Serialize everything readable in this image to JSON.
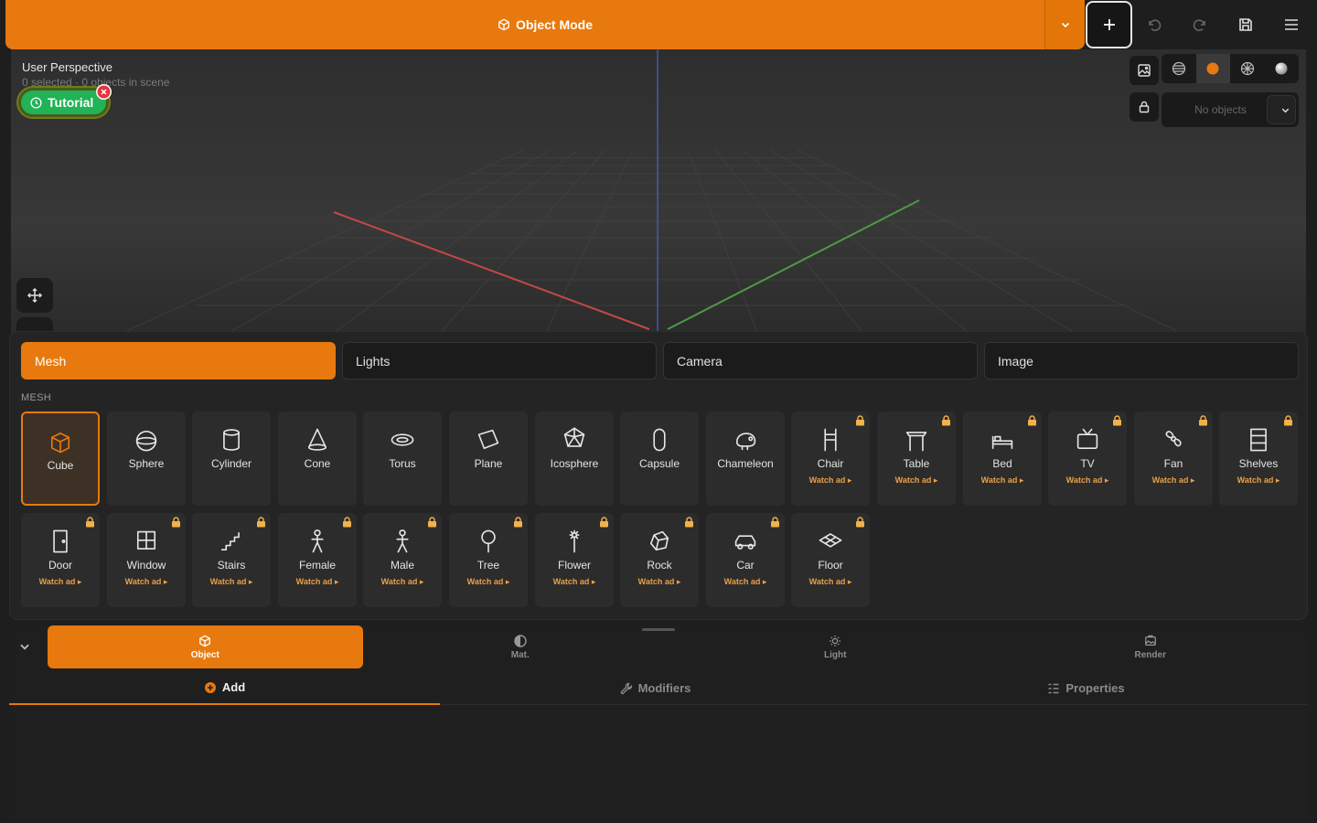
{
  "topbar": {
    "mode_label": "Object Mode",
    "icons": [
      "cube-icon",
      "chevron-down-icon",
      "plus-icon",
      "undo-icon",
      "redo-icon",
      "save-icon",
      "menu-icon"
    ]
  },
  "viewport": {
    "title": "User Perspective",
    "subtitle": "0 selected · 0 objects in scene",
    "tutorial_label": "Tutorial",
    "object_select_placeholder": "No objects",
    "shading_modes": [
      "wireframe",
      "solid",
      "material",
      "rendered"
    ],
    "active_shading": "solid"
  },
  "add_panel": {
    "categories": [
      "Mesh",
      "Lights",
      "Camera",
      "Image"
    ],
    "active_category": "Mesh",
    "section_label": "MESH",
    "ad_label": "Watch ad ▸",
    "items": [
      {
        "name": "Cube",
        "locked": false,
        "selected": true
      },
      {
        "name": "Sphere",
        "locked": false
      },
      {
        "name": "Cylinder",
        "locked": false
      },
      {
        "name": "Cone",
        "locked": false
      },
      {
        "name": "Torus",
        "locked": false
      },
      {
        "name": "Plane",
        "locked": false
      },
      {
        "name": "Icosphere",
        "locked": false
      },
      {
        "name": "Capsule",
        "locked": false
      },
      {
        "name": "Chameleon",
        "locked": false
      },
      {
        "name": "Chair",
        "locked": true
      },
      {
        "name": "Table",
        "locked": true
      },
      {
        "name": "Bed",
        "locked": true
      },
      {
        "name": "TV",
        "locked": true
      },
      {
        "name": "Fan",
        "locked": true
      },
      {
        "name": "Shelves",
        "locked": true
      },
      {
        "name": "Door",
        "locked": true
      },
      {
        "name": "Window",
        "locked": true
      },
      {
        "name": "Stairs",
        "locked": true
      },
      {
        "name": "Female",
        "locked": true
      },
      {
        "name": "Male",
        "locked": true
      },
      {
        "name": "Tree",
        "locked": true
      },
      {
        "name": "Flower",
        "locked": true
      },
      {
        "name": "Rock",
        "locked": true
      },
      {
        "name": "Car",
        "locked": true
      },
      {
        "name": "Floor",
        "locked": true
      }
    ]
  },
  "bottom": {
    "main_tabs": [
      {
        "label": "Object",
        "icon": "cube-icon",
        "active": true
      },
      {
        "label": "Mat.",
        "icon": "half-circle-icon"
      },
      {
        "label": "Light",
        "icon": "sun-icon"
      },
      {
        "label": "Render",
        "icon": "image-icon"
      }
    ],
    "sub_tabs": [
      {
        "label": "Add",
        "icon": "plus-circle-icon",
        "active": true
      },
      {
        "label": "Modifiers",
        "icon": "wrench-icon"
      },
      {
        "label": "Properties",
        "icon": "list-icon"
      }
    ]
  },
  "colors": {
    "accent": "#e8790e",
    "tutorial_green": "#21b356",
    "background": "#1e1e1e"
  }
}
